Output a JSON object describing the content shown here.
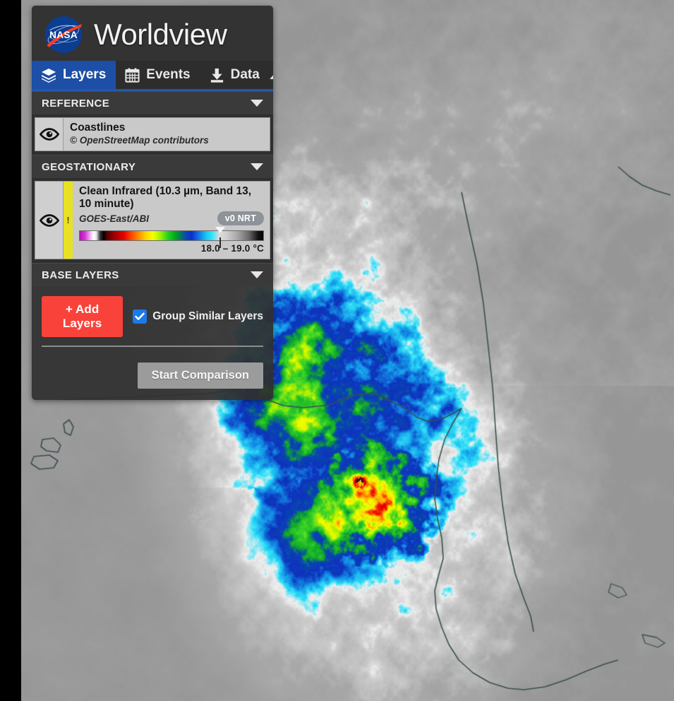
{
  "app": {
    "title": "Worldview",
    "logo_icon": "nasa-meatball-logo"
  },
  "tabs": [
    {
      "id": "layers",
      "label": "Layers",
      "icon": "layers-stack-icon",
      "active": true
    },
    {
      "id": "events",
      "label": "Events",
      "icon": "calendar-icon",
      "active": false
    },
    {
      "id": "data",
      "label": "Data",
      "icon": "download-icon",
      "active": false
    }
  ],
  "collapse_icon": "chevron-up-icon",
  "sections": {
    "reference": {
      "title": "REFERENCE",
      "caret_icon": "caret-down-icon",
      "layers": [
        {
          "name": "Coastlines",
          "subtitle": "© OpenStreetMap contributors",
          "visibility_icon": "eye-icon"
        }
      ]
    },
    "geostationary": {
      "title": "GEOSTATIONARY",
      "caret_icon": "caret-down-icon",
      "layers": [
        {
          "name": "Clean Infrared (10.3 µm, Band 13, 10 minute)",
          "subtitle": "GOES-East/ABI",
          "badge": "v0 NRT",
          "visibility_icon": "eye-icon",
          "warning_icon": "exclamation-icon",
          "colorbar_range": "18.0 – 19.0 °C",
          "colorbar_handle_percent": 73.5
        }
      ]
    },
    "base_layers": {
      "title": "BASE LAYERS",
      "caret_icon": "caret-down-icon"
    }
  },
  "actions": {
    "add_layers_label": "+ Add Layers",
    "group_similar_label": "Group Similar Layers",
    "group_similar_checked": true,
    "check_icon": "checkmark-icon",
    "start_comparison_label": "Start Comparison"
  },
  "colors": {
    "accent_red": "#f9423a",
    "accent_blue": "#1c4fa5",
    "checkbox_blue": "#1c79e8",
    "warning_yellow": "#e8e124",
    "panel_bg": "#2f2f2f",
    "section_bg": "#3a3a3a",
    "card_bg": "#c9c9c9",
    "compare_btn_bg": "#9b9b9b"
  },
  "map": {
    "description": "GOES-East Clean Infrared satellite imagery of a hurricane over the Florida peninsula with gray land/sea background and rainbow-enhanced cold cloud tops",
    "coastline_color": "#3a4f4f",
    "background_gray": "#8a8a8a"
  }
}
